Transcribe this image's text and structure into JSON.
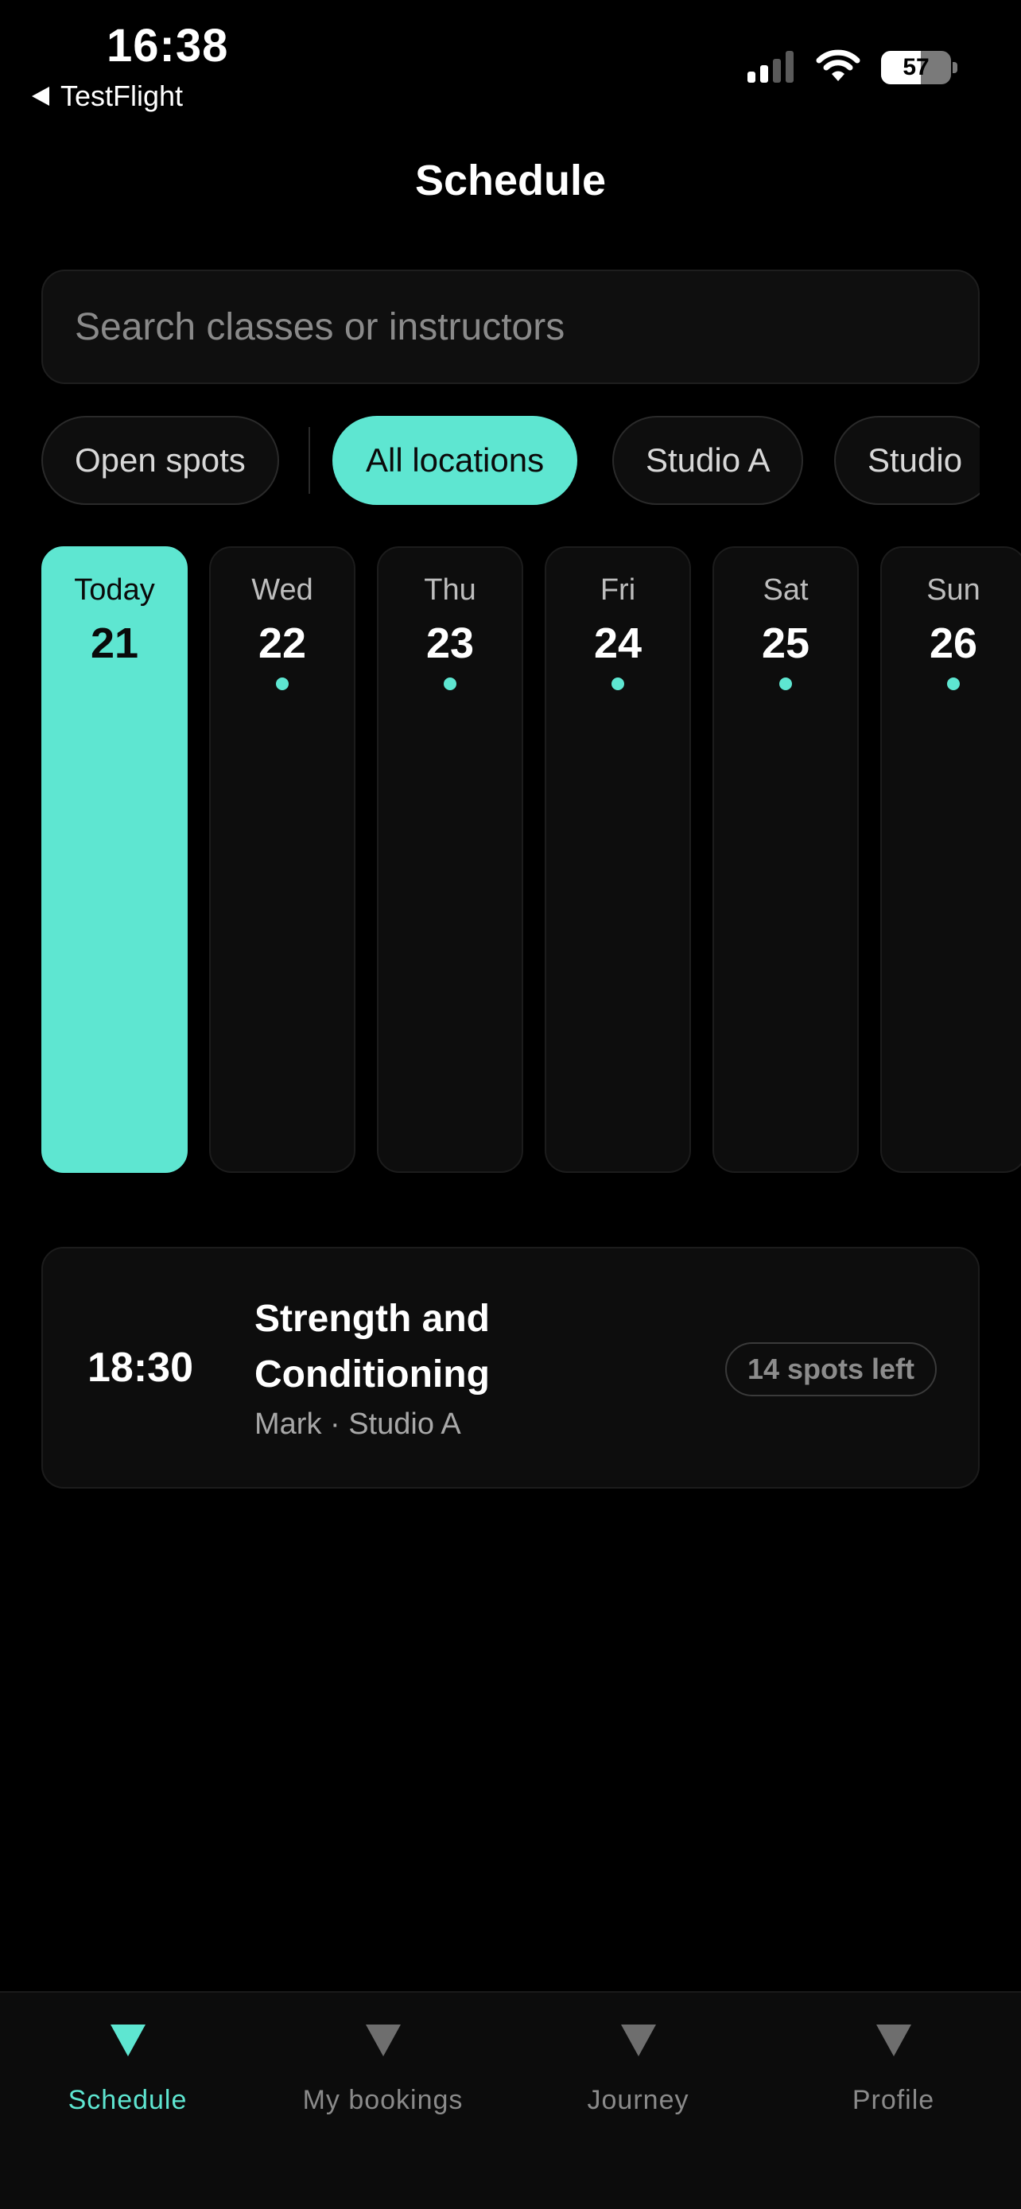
{
  "status": {
    "time": "16:38",
    "back_app": "TestFlight",
    "battery": "57",
    "battery_level": 0.57
  },
  "header": {
    "title": "Schedule"
  },
  "search": {
    "placeholder": "Search classes or instructors",
    "value": ""
  },
  "filters": [
    {
      "label": "Open spots",
      "active": false
    },
    {
      "label": "All locations",
      "active": true
    },
    {
      "label": "Studio A",
      "active": false
    },
    {
      "label": "Studio",
      "active": false
    }
  ],
  "days": [
    {
      "name": "Today",
      "num": "21",
      "active": true,
      "has_classes": false
    },
    {
      "name": "Wed",
      "num": "22",
      "active": false,
      "has_classes": true
    },
    {
      "name": "Thu",
      "num": "23",
      "active": false,
      "has_classes": true
    },
    {
      "name": "Fri",
      "num": "24",
      "active": false,
      "has_classes": true
    },
    {
      "name": "Sat",
      "num": "25",
      "active": false,
      "has_classes": true
    },
    {
      "name": "Sun",
      "num": "26",
      "active": false,
      "has_classes": true
    }
  ],
  "classes": [
    {
      "time": "18:30",
      "title": "Strength and Conditioning",
      "meta": "Mark · Studio A",
      "spots": "14 spots left"
    }
  ],
  "tabs": [
    {
      "label": "Schedule",
      "active": true
    },
    {
      "label": "My bookings",
      "active": false
    },
    {
      "label": "Journey",
      "active": false
    },
    {
      "label": "Profile",
      "active": false
    }
  ],
  "colors": {
    "accent": "#5ee6d1",
    "background": "#000000",
    "card": "#0d0d0d"
  }
}
